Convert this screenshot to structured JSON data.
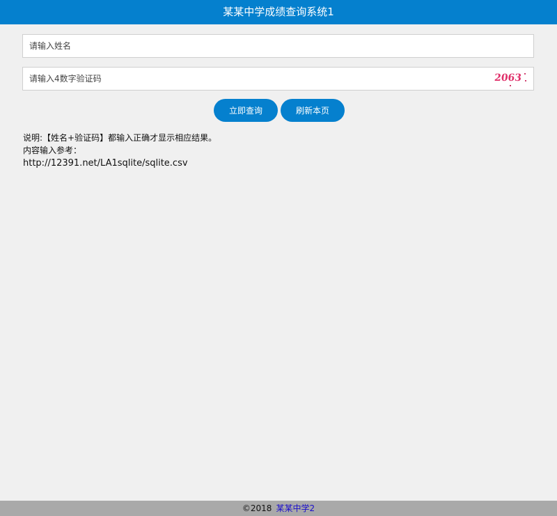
{
  "header": {
    "title": "某某中学成绩查询系统1"
  },
  "form": {
    "name_input": {
      "placeholder": "请输入姓名",
      "value": ""
    },
    "code_input": {
      "placeholder": "请输入4数字验证码",
      "value": ""
    },
    "captcha": {
      "text": "2063"
    }
  },
  "buttons": {
    "query_label": "立即查询",
    "refresh_label": "刷新本页"
  },
  "note": {
    "line1": "说明:【姓名+验证码】都输入正确才显示相应结果。",
    "line2": "内容输入参考：",
    "url": "http://12391.net/LA1sqlite/sqlite.csv"
  },
  "footer": {
    "copyright": "©2018",
    "link_label": "某某中学2"
  },
  "colors": {
    "brand": "#0580ce",
    "captcha": "#e0306a",
    "footer_bg": "#a9a9a9",
    "link": "#1a0dcc"
  }
}
